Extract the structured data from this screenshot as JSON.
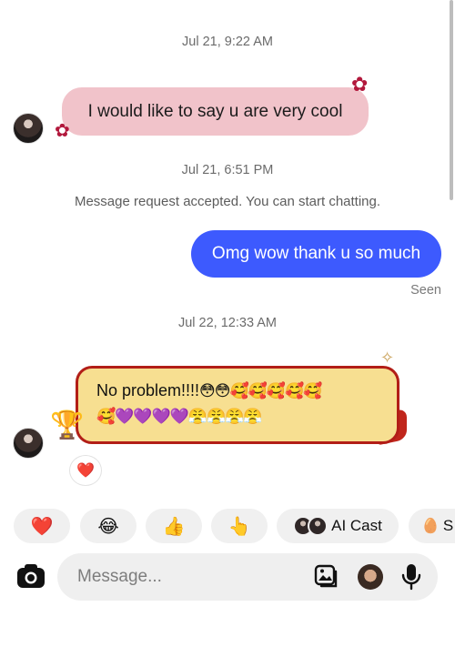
{
  "messages": {
    "ts1": "Jul 21, 9:22 AM",
    "msg1": "I would like to say u are very cool",
    "ts2": "Jul 21, 6:51 PM",
    "system": "Message request accepted. You can start chatting.",
    "msg2": "Omg wow thank u so much",
    "seen": "Seen",
    "ts3": "Jul 22, 12:33 AM",
    "msg3_text": "No problem!!!!",
    "msg3_emoji_line1": "😳😳🥰🥰🥰🥰🥰",
    "msg3_emoji_line2": "🥰💜💜💜💜😤😤😤😤",
    "reaction": "❤️"
  },
  "quick_replies": [
    {
      "label": "❤️"
    },
    {
      "label": "😂"
    },
    {
      "label": "👍"
    },
    {
      "label": "👆"
    },
    {
      "label": "AI Cast"
    },
    {
      "label": "S"
    }
  ],
  "composer": {
    "placeholder": "Message..."
  },
  "icons": {
    "camera": "camera-icon",
    "gallery": "gallery-icon",
    "avatar": "avatar-sticker-icon",
    "mic": "microphone-icon"
  },
  "colors": {
    "sent_bubble": "#3d5afe",
    "pink_bubble": "#f1c3ca",
    "gold_bubble": "#f7df91",
    "gold_border": "#b21e17"
  }
}
